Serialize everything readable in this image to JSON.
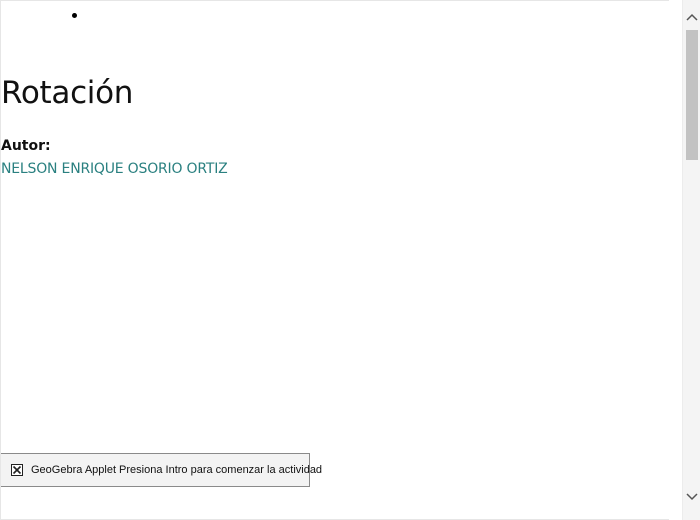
{
  "content": {
    "title": "Rotación",
    "author_label": "Autor:",
    "author_name": "NELSON ENRIQUE OSORIO ORTIZ"
  },
  "applet": {
    "label": "GeoGebra Applet Presiona Intro para comenzar la actividad",
    "icon": "broken-image-icon"
  },
  "scrollbar": {
    "up_icon": "chevron-up-icon",
    "down_icon": "chevron-down-icon"
  },
  "colors": {
    "author_link": "#2a8080",
    "title_text": "#111111"
  }
}
